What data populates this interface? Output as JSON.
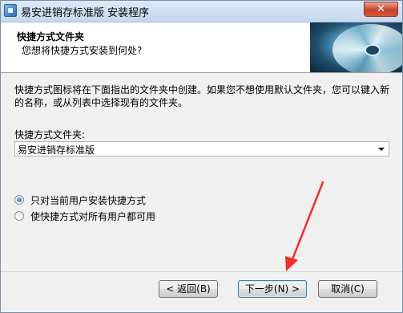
{
  "window": {
    "title": "易安进销存标准版 安装程序",
    "close_label": "✕"
  },
  "header": {
    "title": "快捷方式文件夹",
    "subtitle": "您想将快捷方式安装到何处?"
  },
  "main": {
    "description": "快捷方式图标将在下面指出的文件夹中创建。如果您不想使用默认文件夹，您可以键入新的名称，或从列表中选择现有的文件夹。",
    "folder_label": "快捷方式文件夹:",
    "folder_value": "易安进销存标准版",
    "options": [
      {
        "label": "只对当前用户安装快捷方式",
        "checked": true
      },
      {
        "label": "使快捷方式对所有用户都可用",
        "checked": false
      }
    ]
  },
  "buttons": {
    "back": "< 返回(B)",
    "next": "下一步(N) >",
    "cancel": "取消(C)"
  },
  "annotation": {
    "arrow_color": "#ff2a2a"
  }
}
